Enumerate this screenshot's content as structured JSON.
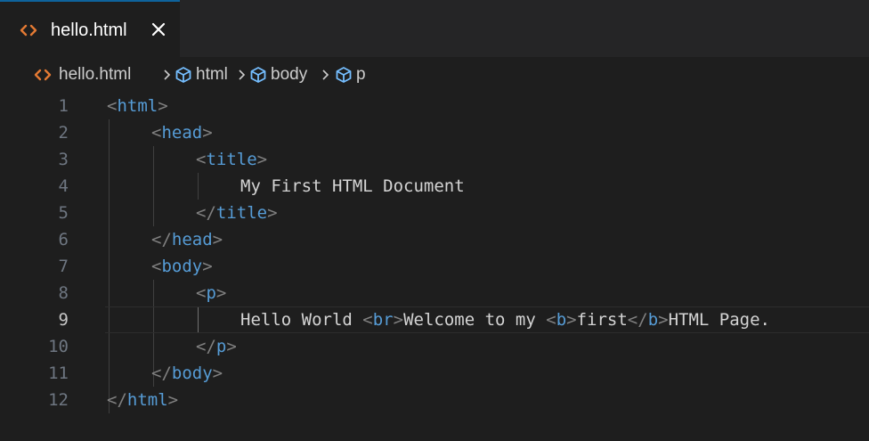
{
  "tab": {
    "label": "hello.html",
    "icon": "html-file-icon",
    "close_icon": "close-icon"
  },
  "breadcrumb": {
    "items": [
      {
        "label": "hello.html",
        "icon": "html-file-icon"
      },
      {
        "label": "html",
        "icon": "symbol-element-icon"
      },
      {
        "label": "body",
        "icon": "symbol-element-icon"
      },
      {
        "label": "p",
        "icon": "symbol-element-icon"
      }
    ]
  },
  "editor": {
    "current_line": 9,
    "lines": [
      {
        "num": "1",
        "parts": [
          [
            "punc",
            "<"
          ],
          [
            "tag",
            "html"
          ],
          [
            "punc",
            ">"
          ]
        ]
      },
      {
        "num": "2",
        "parts": [
          [
            "punc",
            "<"
          ],
          [
            "tag",
            "head"
          ],
          [
            "punc",
            ">"
          ]
        ]
      },
      {
        "num": "3",
        "parts": [
          [
            "punc",
            "<"
          ],
          [
            "tag",
            "title"
          ],
          [
            "punc",
            ">"
          ]
        ]
      },
      {
        "num": "4",
        "parts": [
          [
            "txt",
            "My First HTML Document"
          ]
        ]
      },
      {
        "num": "5",
        "parts": [
          [
            "punc",
            "</"
          ],
          [
            "tag",
            "title"
          ],
          [
            "punc",
            ">"
          ]
        ]
      },
      {
        "num": "6",
        "parts": [
          [
            "punc",
            "</"
          ],
          [
            "tag",
            "head"
          ],
          [
            "punc",
            ">"
          ]
        ]
      },
      {
        "num": "7",
        "parts": [
          [
            "punc",
            "<"
          ],
          [
            "tag",
            "body"
          ],
          [
            "punc",
            ">"
          ]
        ]
      },
      {
        "num": "8",
        "parts": [
          [
            "punc",
            "<"
          ],
          [
            "tag",
            "p"
          ],
          [
            "punc",
            ">"
          ]
        ]
      },
      {
        "num": "9",
        "parts": [
          [
            "txt",
            "Hello World "
          ],
          [
            "punc",
            "<"
          ],
          [
            "tag",
            "br"
          ],
          [
            "punc",
            ">"
          ],
          [
            "txt",
            "Welcome to my "
          ],
          [
            "punc",
            "<"
          ],
          [
            "tag",
            "b"
          ],
          [
            "punc",
            ">"
          ],
          [
            "txt",
            "first"
          ],
          [
            "punc",
            "</"
          ],
          [
            "tag",
            "b"
          ],
          [
            "punc",
            ">"
          ],
          [
            "txt",
            "HTML Page."
          ]
        ]
      },
      {
        "num": "10",
        "parts": [
          [
            "punc",
            "</"
          ],
          [
            "tag",
            "p"
          ],
          [
            "punc",
            ">"
          ]
        ]
      },
      {
        "num": "11",
        "parts": [
          [
            "punc",
            "</"
          ],
          [
            "tag",
            "body"
          ],
          [
            "punc",
            ">"
          ]
        ]
      },
      {
        "num": "12",
        "parts": [
          [
            "punc",
            "</"
          ],
          [
            "tag",
            "html"
          ],
          [
            "punc",
            ">"
          ]
        ]
      }
    ]
  },
  "colors": {
    "background": "#1e1e1e",
    "tab_bar": "#252526",
    "tag": "#569cd6",
    "punctuation": "#808080",
    "text": "#d4d4d4",
    "line_number": "#6e7681",
    "html_icon": "#e37933",
    "symbol_icon": "#75beff"
  }
}
